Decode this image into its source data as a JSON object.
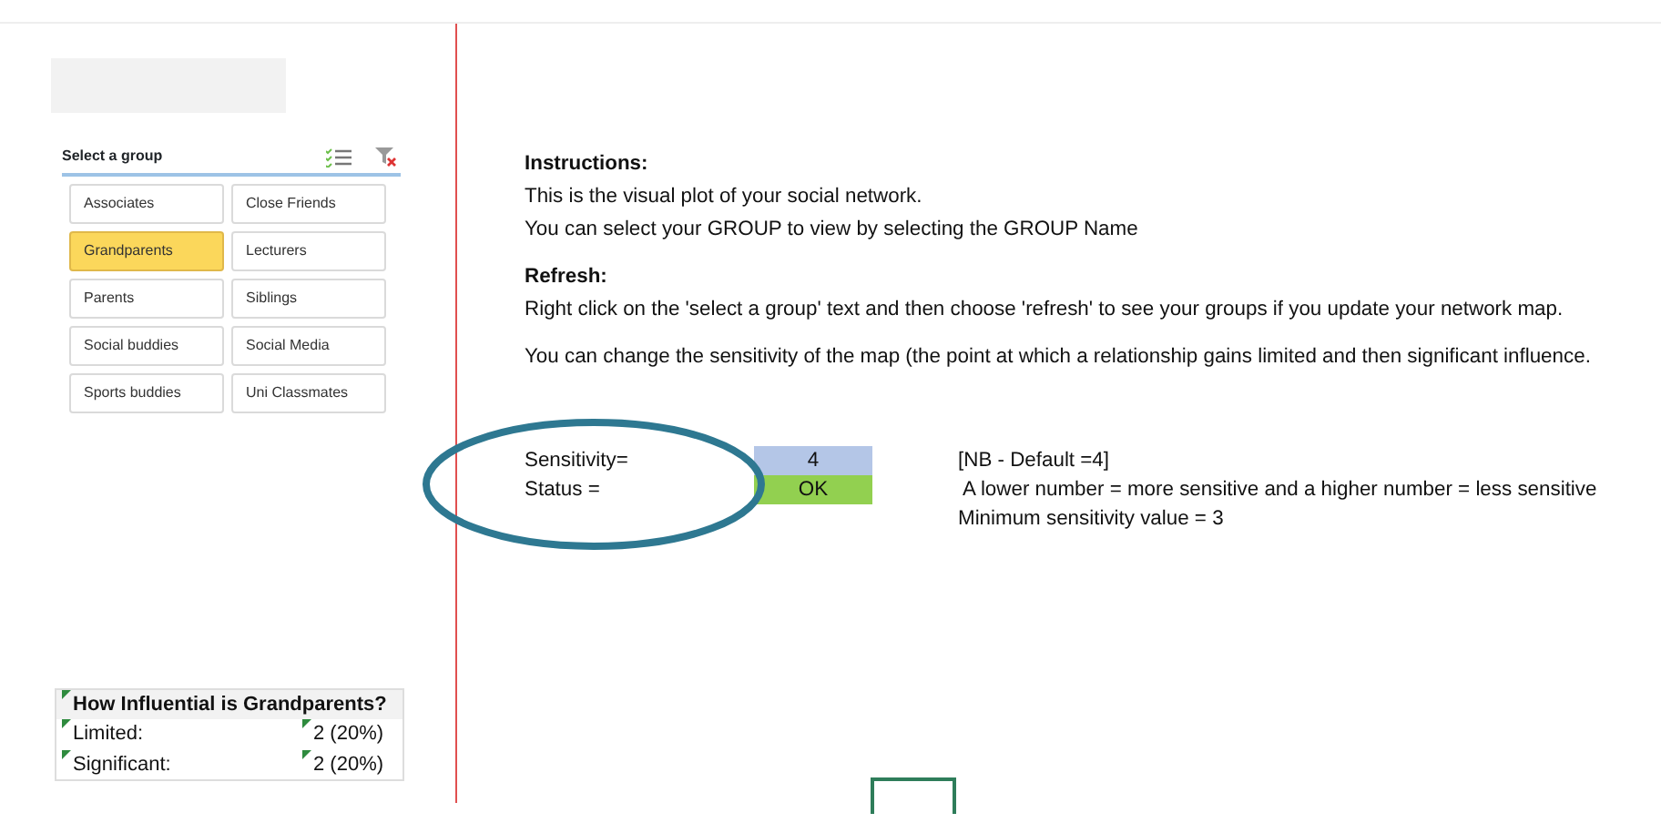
{
  "slicer": {
    "title": "Select a group",
    "items": [
      {
        "label": "Associates",
        "selected": false
      },
      {
        "label": "Close Friends",
        "selected": false
      },
      {
        "label": "Grandparents",
        "selected": true
      },
      {
        "label": "Lecturers",
        "selected": false
      },
      {
        "label": "Parents",
        "selected": false
      },
      {
        "label": "Siblings",
        "selected": false
      },
      {
        "label": "Social buddies",
        "selected": false
      },
      {
        "label": "Social Media",
        "selected": false
      },
      {
        "label": "Sports buddies",
        "selected": false
      },
      {
        "label": "Uni Classmates",
        "selected": false
      }
    ]
  },
  "summary": {
    "title": "How Influential is Grandparents?",
    "rows": [
      {
        "label": "Limited:",
        "value": "2 (20%)"
      },
      {
        "label": "Significant:",
        "value": "2 (20%)"
      }
    ]
  },
  "instructions": {
    "heading": "Instructions:",
    "lines": [
      "This is the visual plot of your social network.",
      "You can select your GROUP  to view by selecting the GROUP Name"
    ]
  },
  "refresh": {
    "heading": "Refresh:",
    "lines": [
      "Right click on the 'select a group' text and then choose 'refresh' to see your groups if you update your network map."
    ]
  },
  "sensitivity_note": "You can change the sensitivity of the map (the point at which a relationship gains limited and then significant influence.",
  "settings": [
    {
      "label": "Sensitivity=",
      "value": "4",
      "color": "#b4c6e7"
    },
    {
      "label": "Status =",
      "value": "OK",
      "color": "#92d050"
    }
  ],
  "notes": [
    "[NB - Default =4]",
    " A lower number = more sensitive and a higher number = less sensitive",
    "Minimum sensitivity value = 3"
  ]
}
